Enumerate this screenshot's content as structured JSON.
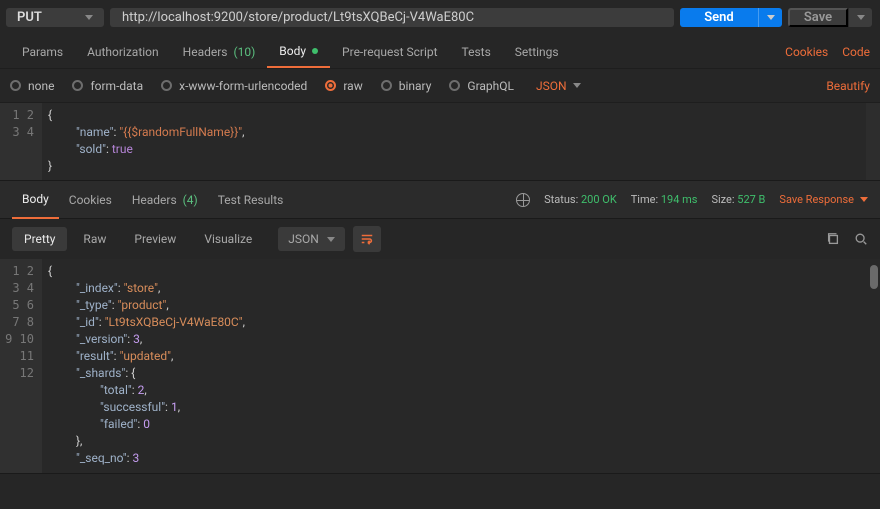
{
  "request": {
    "method": "PUT",
    "url": "http://localhost:9200/store/product/Lt9tsXQBeCj-V4WaE80C",
    "send_label": "Send",
    "save_label": "Save"
  },
  "reqTabs": {
    "params": "Params",
    "auth": "Authorization",
    "headers": "Headers",
    "headers_count": "(10)",
    "body": "Body",
    "prereq": "Pre-request Script",
    "tests": "Tests",
    "settings": "Settings",
    "cookies": "Cookies",
    "code": "Code"
  },
  "bodyTypes": {
    "none": "none",
    "formdata": "form-data",
    "urlenc": "x-www-form-urlencoded",
    "raw": "raw",
    "binary": "binary",
    "graphql": "GraphQL",
    "lang": "JSON",
    "beautify": "Beautify"
  },
  "reqEditor": {
    "lines": [
      "1",
      "2",
      "3",
      "4"
    ],
    "l1": "{",
    "l2_key": "\"name\"",
    "l2_val": "\"{{$randomFullName}}\"",
    "l3_key": "\"sold\"",
    "l3_val": "true",
    "l4": "}"
  },
  "respTabs": {
    "body": "Body",
    "cookies": "Cookies",
    "headers": "Headers",
    "headers_count": "(4)",
    "tests": "Test Results"
  },
  "status": {
    "status_lbl": "Status:",
    "status_val": "200 OK",
    "time_lbl": "Time:",
    "time_val": "194 ms",
    "size_lbl": "Size:",
    "size_val": "527 B",
    "save_response": "Save Response"
  },
  "respTool": {
    "pretty": "Pretty",
    "raw": "Raw",
    "preview": "Preview",
    "visualize": "Visualize",
    "lang": "JSON"
  },
  "respEditor": {
    "lines": [
      "1",
      "2",
      "3",
      "4",
      "5",
      "6",
      "7",
      "8",
      "9",
      "10",
      "11",
      "12"
    ],
    "rows": [
      {
        "t": "punc",
        "text": "{"
      },
      {
        "k": "\"_index\"",
        "vs": "\"store\"",
        "comma": true
      },
      {
        "k": "\"_type\"",
        "vs": "\"product\"",
        "comma": true
      },
      {
        "k": "\"_id\"",
        "vs": "\"Lt9tsXQBeCj-V4WaE80C\"",
        "comma": true
      },
      {
        "k": "\"_version\"",
        "vn": "3",
        "comma": true
      },
      {
        "k": "\"result\"",
        "vs": "\"updated\"",
        "comma": true
      },
      {
        "k": "\"_shards\"",
        "open": true
      },
      {
        "k2": "\"total\"",
        "vn": "2",
        "comma": true
      },
      {
        "k2": "\"successful\"",
        "vn": "1",
        "comma": true
      },
      {
        "k2": "\"failed\"",
        "vn": "0"
      },
      {
        "close": true,
        "comma": true
      },
      {
        "k": "\"_seq_no\"",
        "vn": "3"
      }
    ]
  }
}
